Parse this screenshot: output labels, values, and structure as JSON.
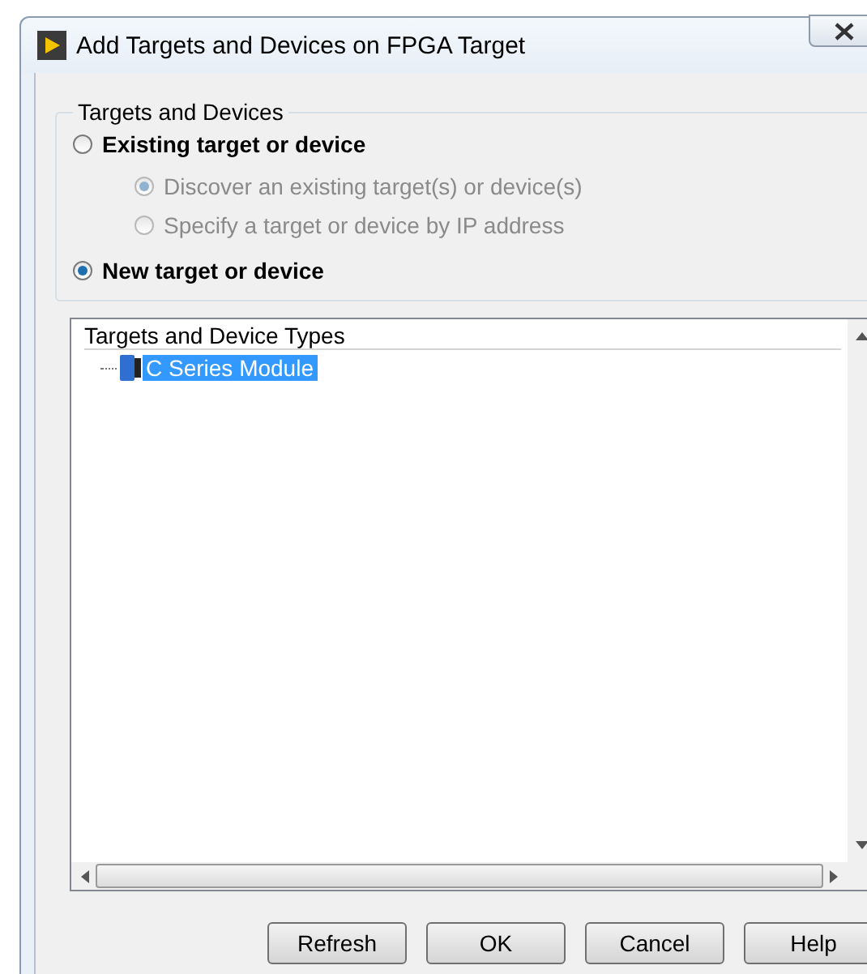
{
  "window": {
    "title": "Add Targets and Devices on FPGA Target"
  },
  "group": {
    "title": "Targets and Devices",
    "options": [
      {
        "label": "Existing target or device",
        "selected": false,
        "disabled": false,
        "children": [
          {
            "label": "Discover an existing target(s) or device(s)",
            "selected": true,
            "disabled": true
          },
          {
            "label": "Specify a target or device by IP address",
            "selected": false,
            "disabled": true
          }
        ]
      },
      {
        "label": "New target or device",
        "selected": true,
        "disabled": false
      }
    ]
  },
  "tree": {
    "header": "Targets and Device Types",
    "items": [
      {
        "label": "C Series Module",
        "selected": true
      }
    ]
  },
  "buttons": [
    "Refresh",
    "OK",
    "Cancel",
    "Help"
  ]
}
